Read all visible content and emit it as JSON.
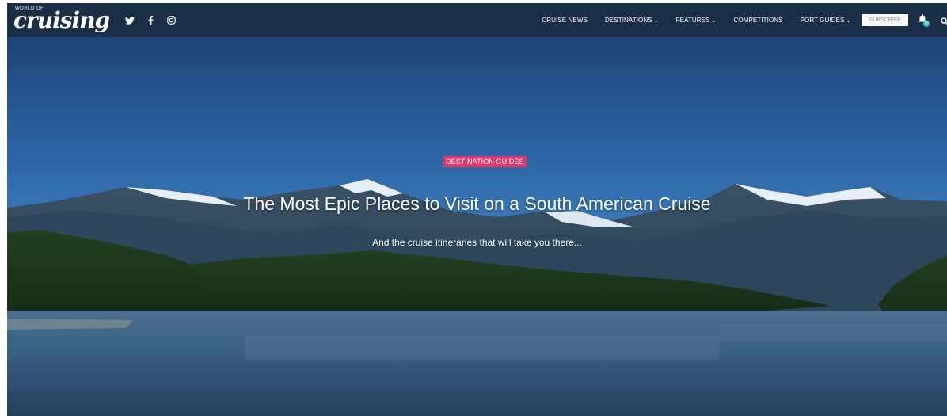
{
  "site": {
    "logo_small": "WORLD OF",
    "logo_main": "cruising"
  },
  "social": [
    {
      "name": "twitter-icon",
      "glyph": "🐦"
    },
    {
      "name": "facebook-icon",
      "glyph": "f"
    },
    {
      "name": "instagram-icon",
      "glyph": "◎"
    }
  ],
  "nav": {
    "items": [
      {
        "label": "CRUISE NEWS",
        "dropdown": false
      },
      {
        "label": "DESTINATIONS",
        "dropdown": true
      },
      {
        "label": "FEATURES",
        "dropdown": true
      },
      {
        "label": "COMPETITIONS",
        "dropdown": false
      },
      {
        "label": "PORT GUIDES",
        "dropdown": true
      }
    ],
    "subscribe_label": "SUBSCRIBE",
    "chevron": "⌄",
    "bell_badge": "0"
  },
  "hero": {
    "category": "DESTINATION GUIDES",
    "title": "The Most Epic Places to Visit on a South American Cruise",
    "subtitle": "And the cruise itineraries that will take you there..."
  },
  "colors": {
    "nav_bg": "#1a2e48",
    "badge": "#e8336b",
    "bell_badge": "#2ec4c4"
  }
}
